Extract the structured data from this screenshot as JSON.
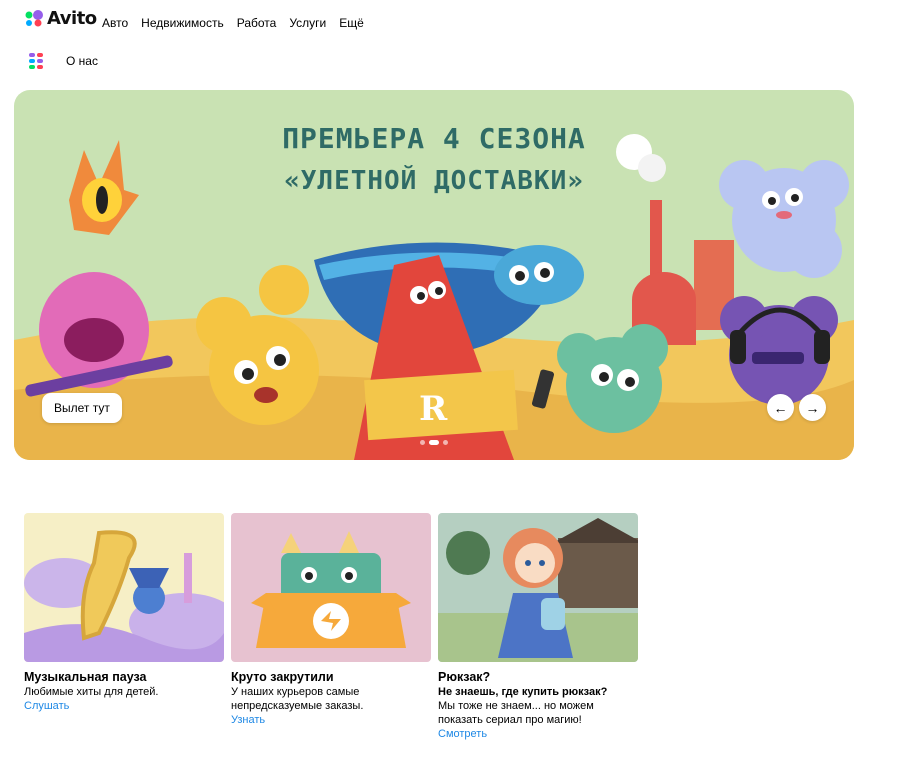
{
  "header": {
    "logo_text": "Avito",
    "nav": [
      "Авто",
      "Недвижимость",
      "Работа",
      "Услуги",
      "Ещё"
    ],
    "about_label": "О нас"
  },
  "hero": {
    "title_line1": "ПРЕМЬЕРА 4 СЕЗОНА",
    "title_line2": "«УЛЕТНОЙ ДОСТАВКИ»",
    "cta_label": "Вылет тут",
    "prev_label": "←",
    "next_label": "→",
    "slides_count": 3,
    "active_slide": 2
  },
  "cards": [
    {
      "title": "Музыкальная пауза",
      "subtitle": "",
      "description": "Любимые хиты для детей.",
      "link": "Слушать"
    },
    {
      "title": "Круто закрутили",
      "subtitle": "",
      "description": "У наших курьеров самые непредсказуемые заказы.",
      "link": "Узнать"
    },
    {
      "title": "Рюкзак?",
      "subtitle": "Не знаешь, где купить рюкзак?",
      "description": "Мы тоже не знаем... но можем показать сериал про магию!",
      "link": "Смотреть"
    }
  ],
  "colors": {
    "link": "#1e88e5",
    "hero_title": "#2f6b66",
    "hero_sky": "#c9e2b3",
    "hero_ground": "#f2c75c"
  }
}
